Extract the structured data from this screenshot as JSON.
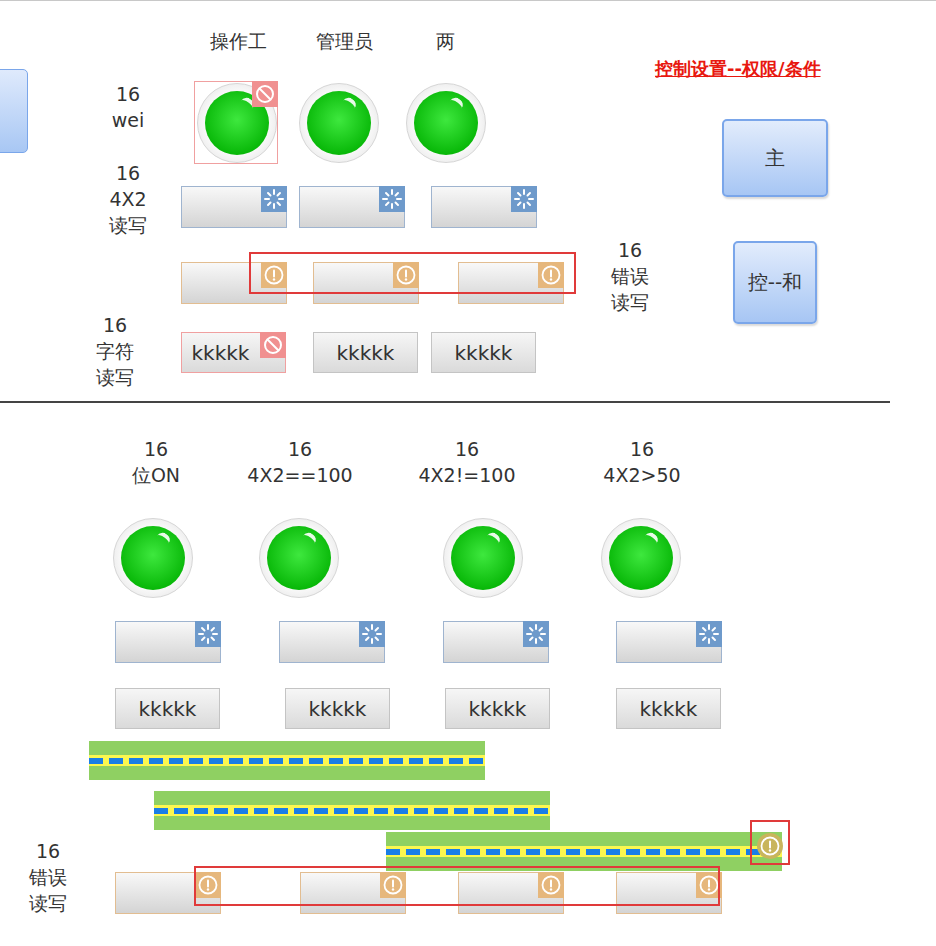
{
  "title": "控制设置--权限/条件",
  "side_buttons": [
    "主",
    "控--和"
  ],
  "permission_panel": {
    "column_headers": [
      "操作工",
      "管理员",
      "两"
    ],
    "lamp_row": {
      "label": [
        "16",
        "wei"
      ],
      "lamps": [
        {
          "on": true,
          "locked": true
        },
        {
          "on": true,
          "locked": false
        },
        {
          "on": true,
          "locked": false
        }
      ]
    },
    "numeric_row": {
      "label": [
        "16",
        "4X2",
        "读写"
      ],
      "fields": [
        {
          "kind": "numeric",
          "locked": false
        },
        {
          "kind": "numeric",
          "locked": false
        },
        {
          "kind": "numeric",
          "locked": false
        }
      ]
    },
    "error_row": {
      "label": [
        "16",
        "错误",
        "读写"
      ],
      "highlighted": true,
      "fields": [
        {
          "kind": "error",
          "locked": false
        },
        {
          "kind": "error",
          "locked": false
        },
        {
          "kind": "error",
          "locked": false
        }
      ]
    },
    "text_row": {
      "label": [
        "16",
        "字符",
        "读写"
      ],
      "buttons": [
        {
          "text": "kkkkk",
          "locked": true
        },
        {
          "text": "kkkkk",
          "locked": false
        },
        {
          "text": "kkkkk",
          "locked": false
        }
      ]
    }
  },
  "condition_panel": {
    "columns": [
      {
        "header": [
          "16",
          "位ON"
        ],
        "lamp_on": true,
        "field_kind": "numeric",
        "button_text": "kkkkk"
      },
      {
        "header": [
          "16",
          "4X2==100"
        ],
        "lamp_on": true,
        "field_kind": "numeric",
        "button_text": "kkkkk"
      },
      {
        "header": [
          "16",
          "4X2!=100"
        ],
        "lamp_on": true,
        "field_kind": "numeric",
        "button_text": "kkkkk"
      },
      {
        "header": [
          "16",
          "4X2>50"
        ],
        "lamp_on": true,
        "field_kind": "numeric",
        "button_text": "kkkkk"
      }
    ],
    "pipes": [
      {
        "warning": false,
        "highlighted": false
      },
      {
        "warning": false,
        "highlighted": false
      },
      {
        "warning": true,
        "highlighted": true
      }
    ],
    "error_row": {
      "label": [
        "16",
        "错误",
        "读写"
      ],
      "highlighted": true,
      "fields": [
        {
          "kind": "error",
          "locked": false
        },
        {
          "kind": "error",
          "locked": false
        },
        {
          "kind": "error",
          "locked": false
        },
        {
          "kind": "error",
          "locked": false
        }
      ]
    }
  }
}
